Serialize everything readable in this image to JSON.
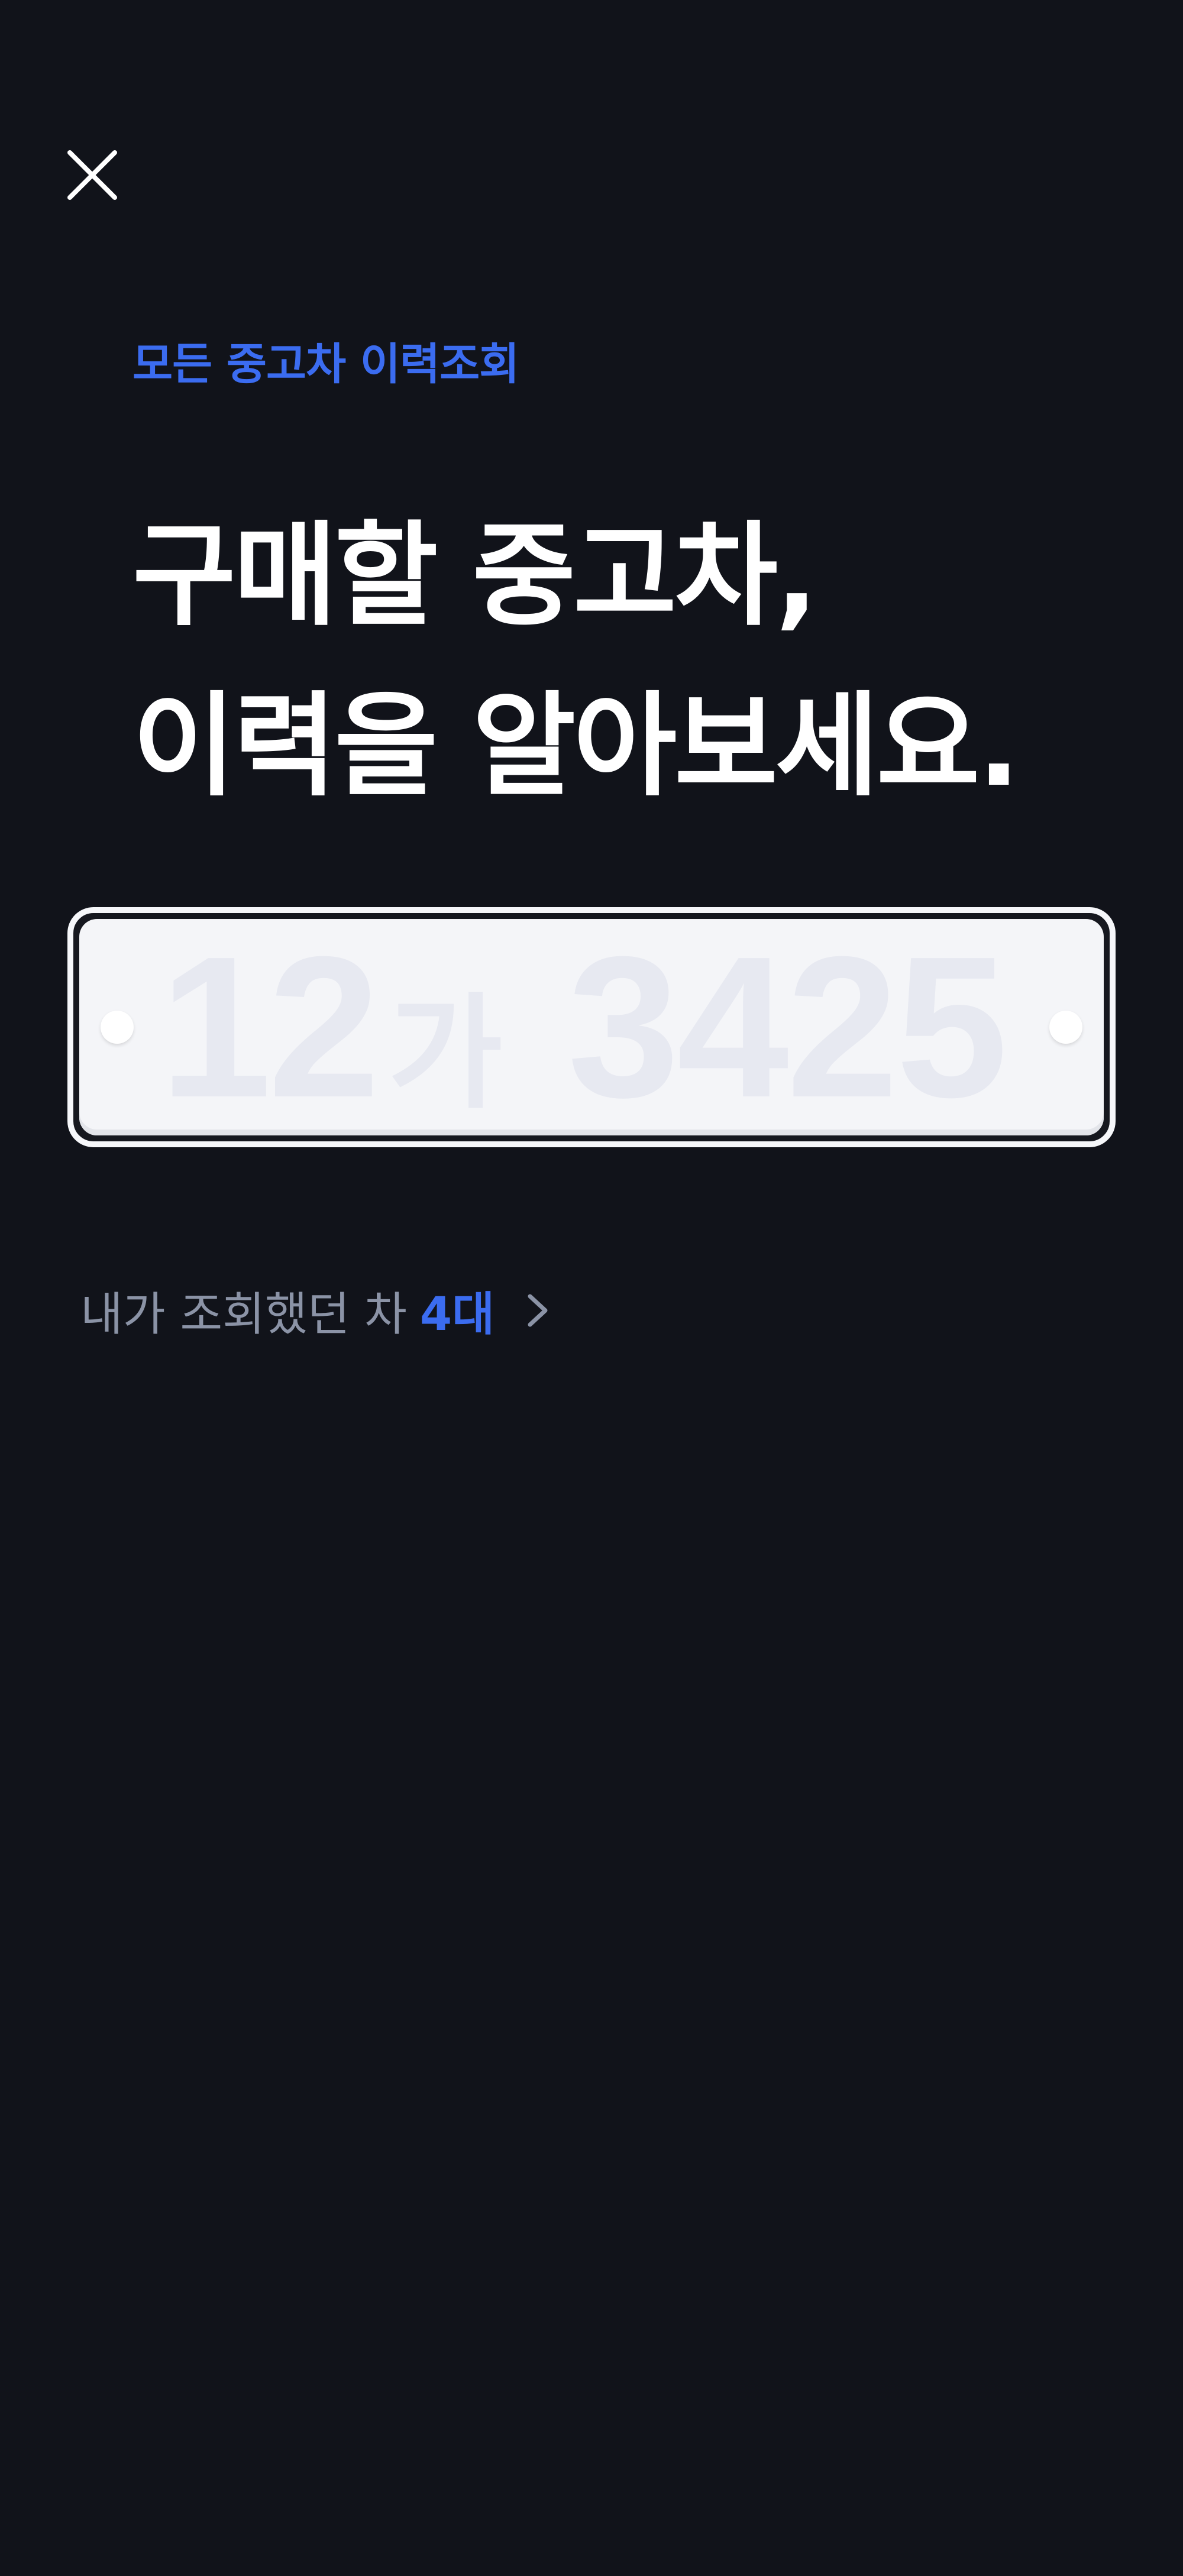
{
  "header": {
    "close_icon": "close-icon"
  },
  "intro": {
    "eyebrow": "모든 중고차 이력조회",
    "headline_line1": "구매할 중고차,",
    "headline_line2": "이력을 알아보세요."
  },
  "plate_input": {
    "placeholder_front": "12",
    "placeholder_hangul": "가",
    "placeholder_back": "3425"
  },
  "history": {
    "label": "내가 조회했던 차",
    "count": "4대",
    "chevron_icon": "chevron-right-icon"
  },
  "colors": {
    "background": "#11131a",
    "accent": "#3b6cf0",
    "muted_text": "#8b93a6",
    "plate_placeholder": "#e7e9f1"
  }
}
